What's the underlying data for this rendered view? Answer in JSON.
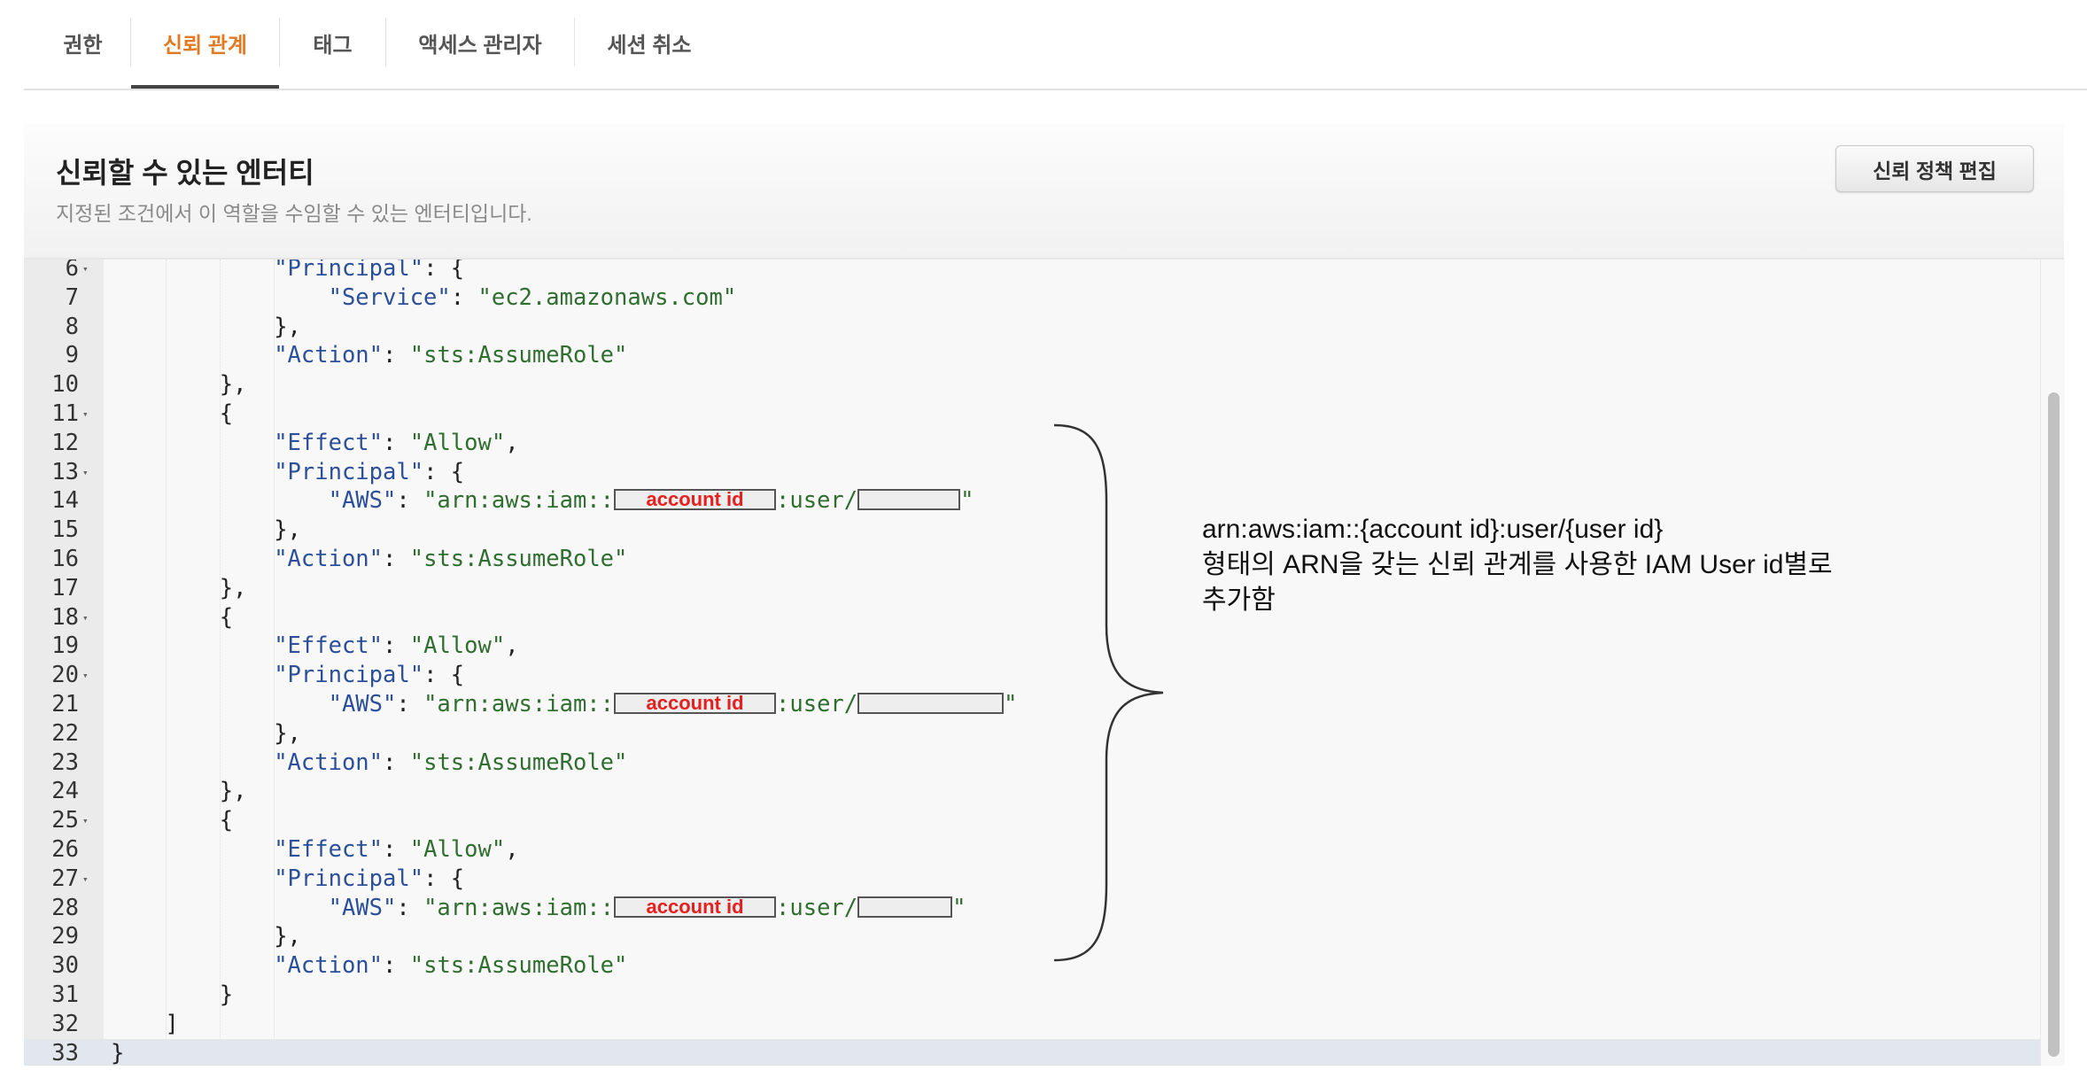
{
  "tabs": [
    {
      "label": "권한",
      "active": false
    },
    {
      "label": "신뢰 관계",
      "active": true
    },
    {
      "label": "태그",
      "active": false
    },
    {
      "label": "액세스 관리자",
      "active": false
    },
    {
      "label": "세션 취소",
      "active": false
    }
  ],
  "section": {
    "title": "신뢰할 수 있는 엔터티",
    "subtitle": "지정된 조건에서 이 역할을 수임할 수 있는 엔터티입니다.",
    "edit_button": "신뢰 정책 편집"
  },
  "colors": {
    "active_tab": "#e07b24",
    "json_key": "#2b4f9a",
    "json_string": "#2f6e2f",
    "redaction_label": "#e5201e"
  },
  "editor": {
    "current_line": 33,
    "lines": [
      {
        "n": 6,
        "fold": true,
        "indent": 12,
        "tokens": [
          [
            "k",
            "\"Principal\""
          ],
          [
            "p",
            ": {"
          ]
        ]
      },
      {
        "n": 7,
        "indent": 16,
        "tokens": [
          [
            "k",
            "\"Service\""
          ],
          [
            "p",
            ": "
          ],
          [
            "s",
            "\"ec2.amazonaws.com\""
          ]
        ]
      },
      {
        "n": 8,
        "indent": 12,
        "tokens": [
          [
            "p",
            "},"
          ]
        ]
      },
      {
        "n": 9,
        "indent": 12,
        "tokens": [
          [
            "k",
            "\"Action\""
          ],
          [
            "p",
            ": "
          ],
          [
            "s",
            "\"sts:AssumeRole\""
          ]
        ]
      },
      {
        "n": 10,
        "indent": 8,
        "tokens": [
          [
            "p",
            "},"
          ]
        ]
      },
      {
        "n": 11,
        "fold": true,
        "indent": 8,
        "tokens": [
          [
            "p",
            "{"
          ]
        ]
      },
      {
        "n": 12,
        "indent": 12,
        "tokens": [
          [
            "k",
            "\"Effect\""
          ],
          [
            "p",
            ": "
          ],
          [
            "s",
            "\"Allow\""
          ],
          [
            "p",
            ","
          ]
        ]
      },
      {
        "n": 13,
        "fold": true,
        "indent": 12,
        "tokens": [
          [
            "k",
            "\"Principal\""
          ],
          [
            "p",
            ": {"
          ]
        ]
      },
      {
        "n": 14,
        "indent": 16,
        "tokens": [
          [
            "k",
            "\"AWS\""
          ],
          [
            "p",
            ": "
          ],
          [
            "s",
            "\"arn:aws:iam::"
          ],
          [
            "r",
            "account id",
            183
          ],
          [
            "s",
            ":user/"
          ],
          [
            "r",
            "",
            116
          ],
          [
            "s",
            "\""
          ]
        ]
      },
      {
        "n": 15,
        "indent": 12,
        "tokens": [
          [
            "p",
            "},"
          ]
        ]
      },
      {
        "n": 16,
        "indent": 12,
        "tokens": [
          [
            "k",
            "\"Action\""
          ],
          [
            "p",
            ": "
          ],
          [
            "s",
            "\"sts:AssumeRole\""
          ]
        ]
      },
      {
        "n": 17,
        "indent": 8,
        "tokens": [
          [
            "p",
            "},"
          ]
        ]
      },
      {
        "n": 18,
        "fold": true,
        "indent": 8,
        "tokens": [
          [
            "p",
            "{"
          ]
        ]
      },
      {
        "n": 19,
        "indent": 12,
        "tokens": [
          [
            "k",
            "\"Effect\""
          ],
          [
            "p",
            ": "
          ],
          [
            "s",
            "\"Allow\""
          ],
          [
            "p",
            ","
          ]
        ]
      },
      {
        "n": 20,
        "fold": true,
        "indent": 12,
        "tokens": [
          [
            "k",
            "\"Principal\""
          ],
          [
            "p",
            ": {"
          ]
        ]
      },
      {
        "n": 21,
        "indent": 16,
        "tokens": [
          [
            "k",
            "\"AWS\""
          ],
          [
            "p",
            ": "
          ],
          [
            "s",
            "\"arn:aws:iam::"
          ],
          [
            "r",
            "account id",
            183
          ],
          [
            "s",
            ":user/"
          ],
          [
            "r",
            "",
            165
          ],
          [
            "s",
            "\""
          ]
        ]
      },
      {
        "n": 22,
        "indent": 12,
        "tokens": [
          [
            "p",
            "},"
          ]
        ]
      },
      {
        "n": 23,
        "indent": 12,
        "tokens": [
          [
            "k",
            "\"Action\""
          ],
          [
            "p",
            ": "
          ],
          [
            "s",
            "\"sts:AssumeRole\""
          ]
        ]
      },
      {
        "n": 24,
        "indent": 8,
        "tokens": [
          [
            "p",
            "},"
          ]
        ]
      },
      {
        "n": 25,
        "fold": true,
        "indent": 8,
        "tokens": [
          [
            "p",
            "{"
          ]
        ]
      },
      {
        "n": 26,
        "indent": 12,
        "tokens": [
          [
            "k",
            "\"Effect\""
          ],
          [
            "p",
            ": "
          ],
          [
            "s",
            "\"Allow\""
          ],
          [
            "p",
            ","
          ]
        ]
      },
      {
        "n": 27,
        "fold": true,
        "indent": 12,
        "tokens": [
          [
            "k",
            "\"Principal\""
          ],
          [
            "p",
            ": {"
          ]
        ]
      },
      {
        "n": 28,
        "indent": 16,
        "tokens": [
          [
            "k",
            "\"AWS\""
          ],
          [
            "p",
            ": "
          ],
          [
            "s",
            "\"arn:aws:iam::"
          ],
          [
            "r",
            "account id",
            183
          ],
          [
            "s",
            ":user/"
          ],
          [
            "r",
            "",
            107
          ],
          [
            "s",
            "\""
          ]
        ]
      },
      {
        "n": 29,
        "indent": 12,
        "tokens": [
          [
            "p",
            "},"
          ]
        ]
      },
      {
        "n": 30,
        "indent": 12,
        "tokens": [
          [
            "k",
            "\"Action\""
          ],
          [
            "p",
            ": "
          ],
          [
            "s",
            "\"sts:AssumeRole\""
          ]
        ]
      },
      {
        "n": 31,
        "indent": 8,
        "tokens": [
          [
            "p",
            "}"
          ]
        ]
      },
      {
        "n": 32,
        "indent": 4,
        "tokens": [
          [
            "p",
            "]"
          ]
        ]
      },
      {
        "n": 33,
        "indent": 0,
        "tokens": [
          [
            "p",
            "}"
          ]
        ]
      }
    ]
  },
  "annotation": {
    "lines": [
      "arn:aws:iam::{account id}:user/{user id}",
      "형태의 ARN을 갖는 신뢰 관계를 사용한 IAM User id별로",
      "추가함"
    ]
  }
}
